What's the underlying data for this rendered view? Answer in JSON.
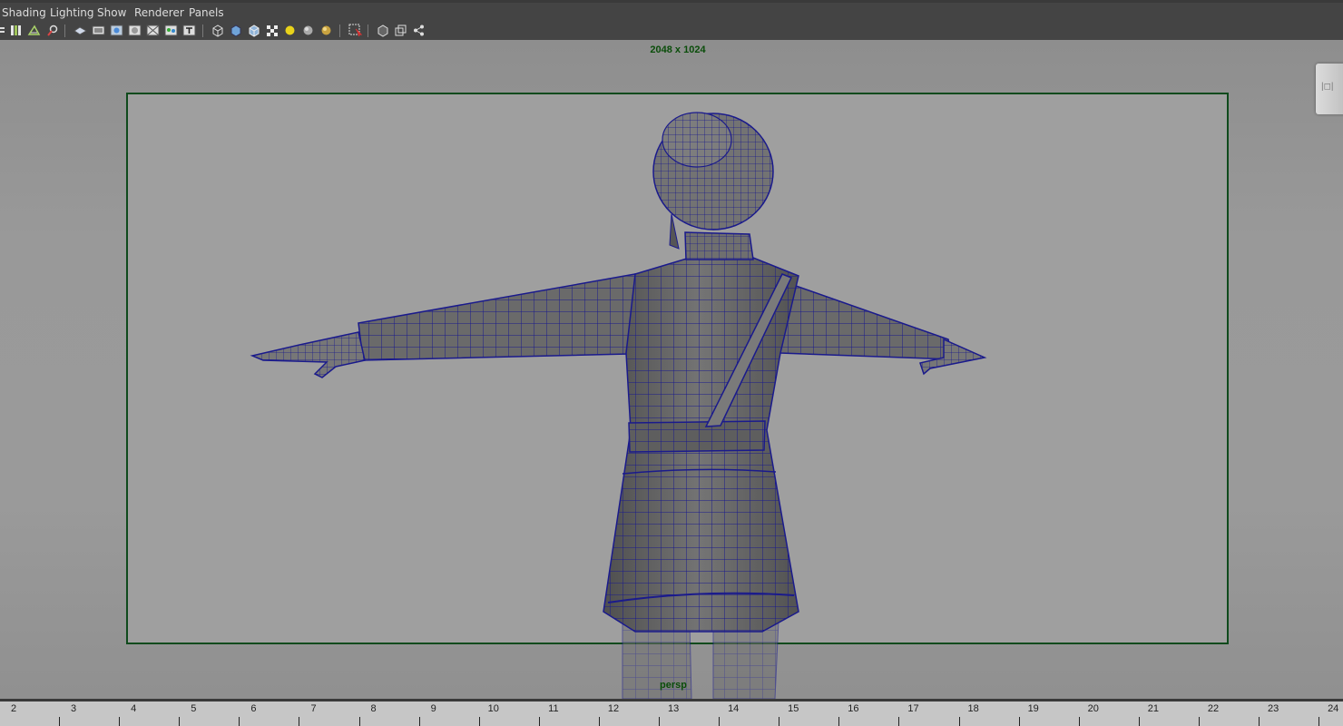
{
  "menu": [
    "Shading",
    "Lighting",
    "Show",
    "Renderer",
    "Panels"
  ],
  "toolbar_icons": [
    "select-camera-icon",
    "camera-attributes-icon",
    "bookmark-icon",
    "image-plane-icon",
    "grid-icon",
    "film-gate-icon",
    "resolution-gate-icon",
    "gate-mask-icon",
    "field-chart-icon",
    "safe-action-icon",
    "safe-title-icon",
    "wireframe-icon",
    "smooth-shade-icon",
    "wireframe-on-shaded-icon",
    "textured-icon",
    "use-all-lights-icon",
    "shadows-icon",
    "ambient-occlusion-icon",
    "isolate-select-icon",
    "xray-icon",
    "xray-joints-icon",
    "xray-components-icon"
  ],
  "viewport": {
    "resolution_label": "2048 x 1024",
    "camera_label": "persp",
    "background_color": "#9a9a9a",
    "gate_color": "#0f4a1c",
    "wireframe_color": "#1a1a8c",
    "model_fill": "#6b6b6b"
  },
  "timeline": {
    "ticks": [
      2,
      3,
      4,
      5,
      6,
      7,
      8,
      9,
      10,
      11,
      12,
      13,
      14,
      15,
      16,
      17,
      18,
      19,
      20,
      21,
      22,
      23,
      24
    ]
  }
}
